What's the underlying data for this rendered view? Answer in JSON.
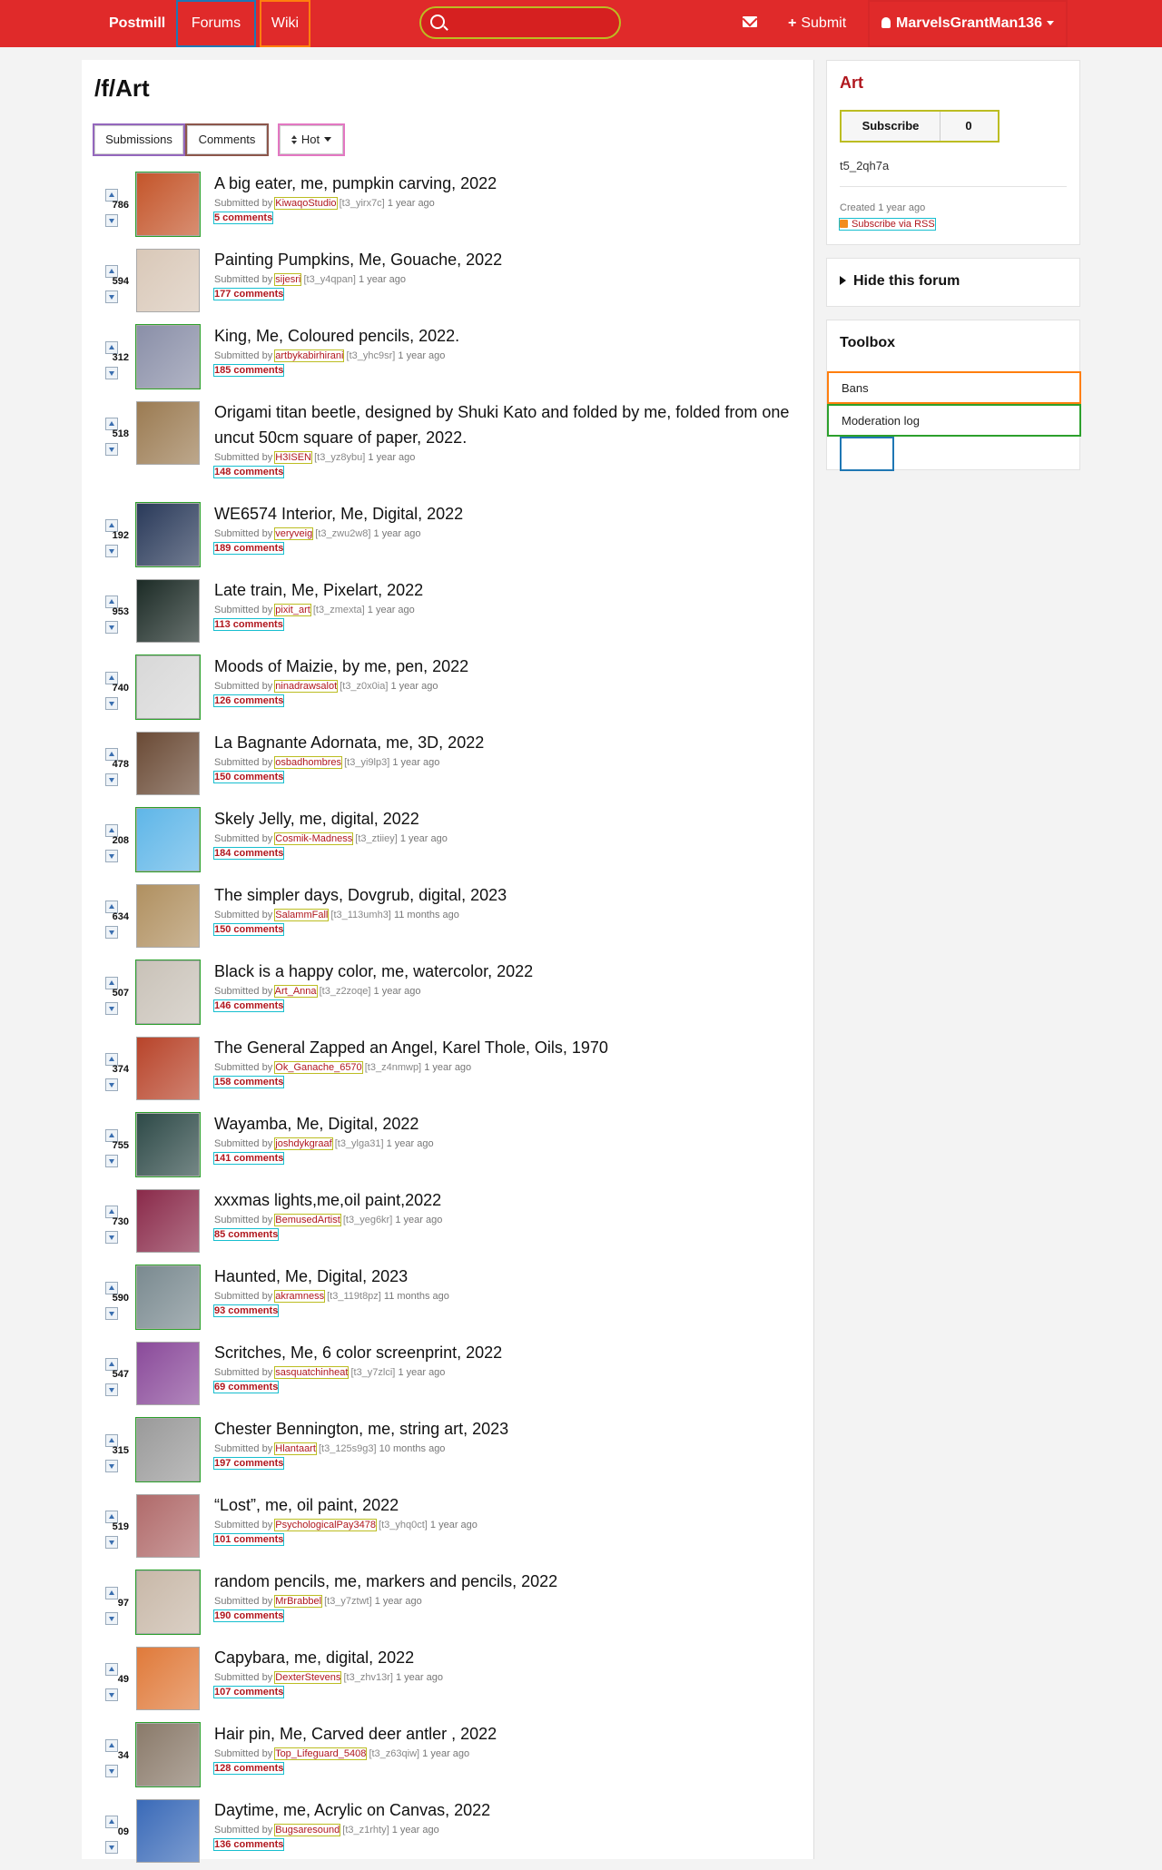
{
  "nav": {
    "brand": "Postmill",
    "forums": "Forums",
    "wiki": "Wiki",
    "search_placeholder": "",
    "submit": "Submit",
    "user": "MarvelsGrantMan136"
  },
  "forum": {
    "title": "/f/Art",
    "tabs": {
      "submissions": "Submissions",
      "comments": "Comments",
      "sort": "Hot"
    }
  },
  "posts": [
    {
      "score": "786",
      "title": "A big eater, me, pumpkin carving, 2022",
      "by": "Submitted by",
      "user": "KiwaqoStudio",
      "tid": "[t3_yirx7c]",
      "time": "1 year ago",
      "comments": "5 comments",
      "thumb": "#c4552a"
    },
    {
      "score": "594",
      "title": "Painting Pumpkins, Me, Gouache, 2022",
      "by": "Submitted by",
      "user": "sijesri",
      "tid": "[t3_y4qpan]",
      "time": "1 year ago",
      "comments": "177 comments",
      "thumb": "#d9c8b8"
    },
    {
      "score": "312",
      "title": "King, Me, Coloured pencils, 2022.",
      "by": "Submitted by",
      "user": "artbykabirhirani",
      "tid": "[t3_yhc9sr]",
      "time": "1 year ago",
      "comments": "185 comments",
      "thumb": "#8a8fa8"
    },
    {
      "score": "518",
      "title": "Origami titan beetle, designed by Shuki Kato and folded by me, folded from one uncut 50cm square of paper, 2022.",
      "by": "Submitted by",
      "user": "H3ISEN",
      "tid": "[t3_yz8ybu]",
      "time": "1 year ago",
      "comments": "148 comments",
      "thumb": "#9b7b52"
    },
    {
      "score": "192",
      "title": "WE6574 Interior, Me, Digital, 2022",
      "by": "Submitted by",
      "user": "veryveig",
      "tid": "[t3_zwu2w8]",
      "time": "1 year ago",
      "comments": "189 comments",
      "thumb": "#2a3a5a"
    },
    {
      "score": "953",
      "title": "Late train, Me, Pixelart, 2022",
      "by": "Submitted by",
      "user": "pixit_art",
      "tid": "[t3_zmexta]",
      "time": "1 year ago",
      "comments": "113 comments",
      "thumb": "#1c2b26"
    },
    {
      "score": "740",
      "title": "Moods of Maizie, by me, pen, 2022",
      "by": "Submitted by",
      "user": "ninadrawsalot",
      "tid": "[t3_z0x0ia]",
      "time": "1 year ago",
      "comments": "126 comments",
      "thumb": "#d8d8d8"
    },
    {
      "score": "478",
      "title": "La Bagnante Adornata, me, 3D, 2022",
      "by": "Submitted by",
      "user": "osbadhombres",
      "tid": "[t3_yi9lp3]",
      "time": "1 year ago",
      "comments": "150 comments",
      "thumb": "#6a4a35"
    },
    {
      "score": "208",
      "title": "Skely Jelly, me, digital, 2022",
      "by": "Submitted by",
      "user": "Cosmik-Madness",
      "tid": "[t3_ztiiey]",
      "time": "1 year ago",
      "comments": "184 comments",
      "thumb": "#5fb6e8"
    },
    {
      "score": "634",
      "title": "The simpler days, Dovgrub, digital, 2023",
      "by": "Submitted by",
      "user": "SalammFall",
      "tid": "[t3_113umh3]",
      "time": "11 months ago",
      "comments": "150 comments",
      "thumb": "#b09060"
    },
    {
      "score": "507",
      "title": "Black is a happy color, me, watercolor, 2022",
      "by": "Submitted by",
      "user": "Art_Anna",
      "tid": "[t3_z2zoqe]",
      "time": "1 year ago",
      "comments": "146 comments",
      "thumb": "#c9c2b8"
    },
    {
      "score": "374",
      "title": "The General Zapped an Angel, Karel Thole, Oils, 1970",
      "by": "Submitted by",
      "user": "Ok_Ganache_6570",
      "tid": "[t3_z4nmwp]",
      "time": "1 year ago",
      "comments": "158 comments",
      "thumb": "#b8442a"
    },
    {
      "score": "755",
      "title": "Wayamba, Me, Digital, 2022",
      "by": "Submitted by",
      "user": "joshdykgraaf",
      "tid": "[t3_ylga31]",
      "time": "1 year ago",
      "comments": "141 comments",
      "thumb": "#2e4a48"
    },
    {
      "score": "730",
      "title": "xxxmas lights,me,oil paint,2022",
      "by": "Submitted by",
      "user": "BemusedArtist",
      "tid": "[t3_yeg6kr]",
      "time": "1 year ago",
      "comments": "85 comments",
      "thumb": "#8a2a4a"
    },
    {
      "score": "590",
      "title": "Haunted, Me, Digital, 2023",
      "by": "Submitted by",
      "user": "akramness",
      "tid": "[t3_119t8pz]",
      "time": "11 months ago",
      "comments": "93 comments",
      "thumb": "#7a8a90"
    },
    {
      "score": "547",
      "title": "Scritches, Me, 6 color screenprint, 2022",
      "by": "Submitted by",
      "user": "sasquatchinheat",
      "tid": "[t3_y7zlci]",
      "time": "1 year ago",
      "comments": "69 comments",
      "thumb": "#8a4a9a"
    },
    {
      "score": "315",
      "title": "Chester Bennington, me, string art, 2023",
      "by": "Submitted by",
      "user": "Hlantaart",
      "tid": "[t3_125s9g3]",
      "time": "10 months ago",
      "comments": "197 comments",
      "thumb": "#9a9a9a"
    },
    {
      "score": "519",
      "title": "“Lost”, me, oil paint, 2022",
      "by": "Submitted by",
      "user": "PsychologicalPay3478",
      "tid": "[t3_yhq0ct]",
      "time": "1 year ago",
      "comments": "101 comments",
      "thumb": "#b06a6a"
    },
    {
      "score": "97",
      "title": "random pencils, me, markers and pencils, 2022",
      "by": "Submitted by",
      "user": "MrBrabbel",
      "tid": "[t3_y7ztwt]",
      "time": "1 year ago",
      "comments": "190 comments",
      "thumb": "#c8b8a8"
    },
    {
      "score": "49",
      "title": "Capybara, me, digital, 2022",
      "by": "Submitted by",
      "user": "DexterStevens",
      "tid": "[t3_zhv13r]",
      "time": "1 year ago",
      "comments": "107 comments",
      "thumb": "#e07a3a"
    },
    {
      "score": "34",
      "title": "Hair pin, Me, Carved deer antler , 2022",
      "by": "Submitted by",
      "user": "Top_Lifeguard_5408",
      "tid": "[t3_z63qiw]",
      "time": "1 year ago",
      "comments": "128 comments",
      "thumb": "#8a7a6a"
    },
    {
      "score": "09",
      "title": "Daytime, me, Acrylic on Canvas, 2022",
      "by": "Submitted by",
      "user": "Bugsaresound",
      "tid": "[t3_z1rhty]",
      "time": "1 year ago",
      "comments": "136 comments",
      "thumb": "#3a6ab8"
    }
  ],
  "sidebar": {
    "title": "Art",
    "subscribe": "Subscribe",
    "subscribers": "0",
    "forum_id": "t5_2qh7a",
    "created_label": "Created",
    "created_time": "1 year ago",
    "rss": "Subscribe via RSS",
    "hide": "Hide this forum",
    "toolbox_title": "Toolbox",
    "bans": "Bans",
    "modlog": "Moderation log"
  },
  "colors": {
    "brand_red": "#e02a2a",
    "link_red": "#b0171e"
  }
}
